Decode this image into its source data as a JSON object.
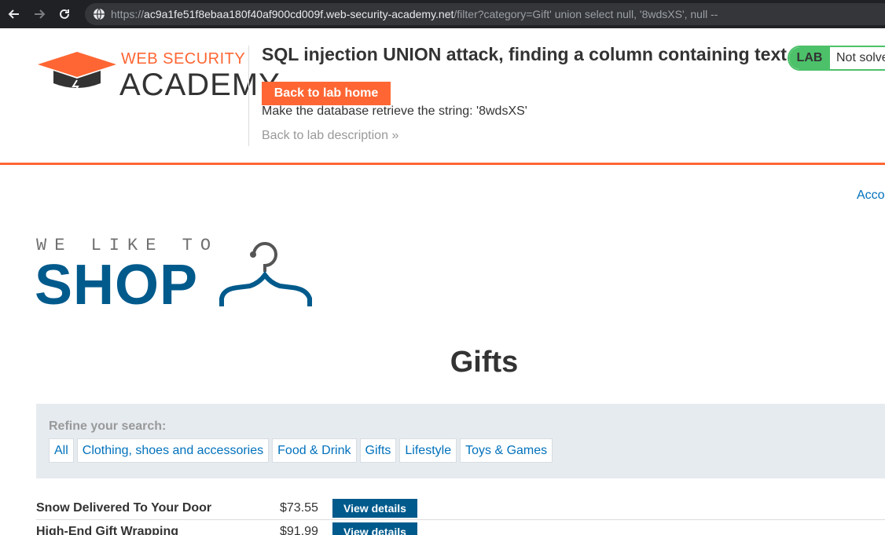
{
  "browser": {
    "url_scheme": "https://",
    "url_host": "ac9a1fe51f8ebaa180f40af900cd009f.web-security-academy.net",
    "url_path": "/filter?category=Gift' union select null, '8wdsXS', null --"
  },
  "academy": {
    "logo_top": "WEB SECURITY",
    "logo_bottom": "ACADEMY",
    "lab_title": "SQL injection UNION attack, finding a column containing text",
    "back_home_label": "Back to lab home",
    "objective": "Make the database retrieve the string: '8wdsXS'",
    "back_description": "Back to lab description",
    "lab_tag": "LAB",
    "lab_status": "Not solved"
  },
  "shop": {
    "account_link": "Account",
    "tagline": "WE LIKE TO",
    "brand": "SHOP",
    "page_heading": "Gifts",
    "filter_label": "Refine your search:",
    "categories": [
      "All",
      "Clothing, shoes and accessories",
      "Food & Drink",
      "Gifts",
      "Lifestyle",
      "Toys & Games"
    ],
    "products": [
      {
        "name": "Snow Delivered To Your Door",
        "price": "$73.55",
        "button": "View details"
      },
      {
        "name": "High-End Gift Wrapping",
        "price": "$91.99",
        "button": "View details"
      }
    ]
  },
  "colors": {
    "accent_orange": "#ff6633",
    "lab_green": "#4cc16a",
    "shop_blue": "#005a8c",
    "link_blue": "#0071bc"
  }
}
